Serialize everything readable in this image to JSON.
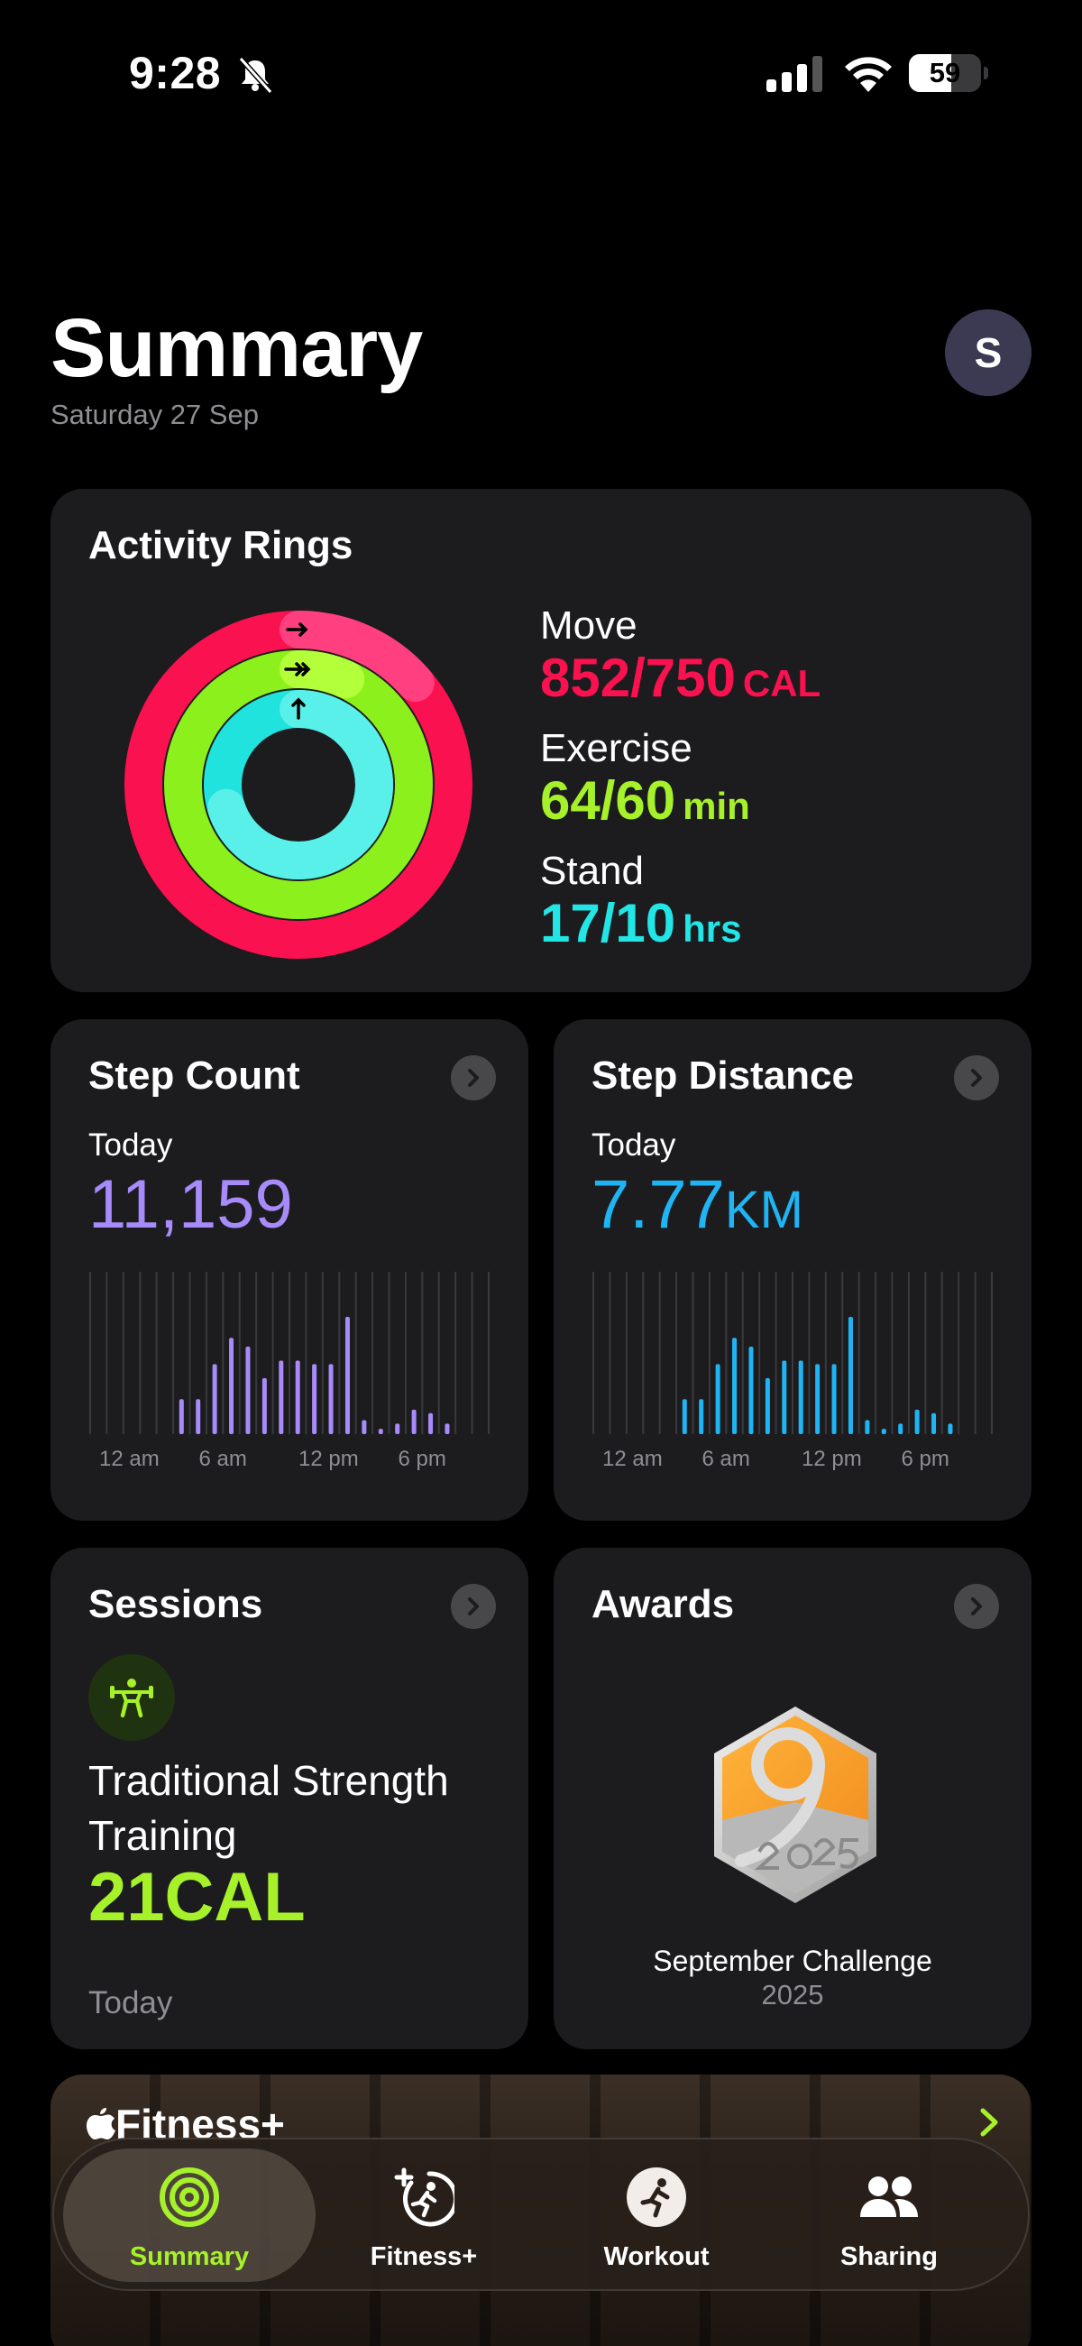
{
  "status_bar": {
    "time": "9:28",
    "battery": "59",
    "battery_level": 0.59
  },
  "header": {
    "title": "Summary",
    "date": "Saturday 27 Sep",
    "avatar_initial": "S"
  },
  "activity": {
    "title": "Activity Rings",
    "move": {
      "label": "Move",
      "value": "852/750",
      "unit": "CAL",
      "progress": 1.136,
      "color": "#fa114f"
    },
    "exercise": {
      "label": "Exercise",
      "value": "64/60",
      "unit": "min",
      "progress": 1.067,
      "color": "#a6f12a"
    },
    "stand": {
      "label": "Stand",
      "value": "17/10",
      "unit": "hrs",
      "progress": 1.7,
      "color": "#22e5e6"
    }
  },
  "step_count": {
    "title": "Step Count",
    "period": "Today",
    "value": "11,159",
    "color": "#a78bfa",
    "axis_labels": [
      "12 am",
      "6 am",
      "12 pm",
      "6 pm"
    ]
  },
  "step_distance": {
    "title": "Step Distance",
    "period": "Today",
    "value": "7.77",
    "unit": "KM",
    "color": "#1fb5f5",
    "axis_labels": [
      "12 am",
      "6 am",
      "12 pm",
      "6 pm"
    ]
  },
  "chart_data": [
    {
      "type": "bar",
      "title": "Step Count",
      "categories": [
        "0",
        "1",
        "2",
        "3",
        "4",
        "5",
        "6",
        "7",
        "8",
        "9",
        "10",
        "11",
        "12",
        "13",
        "14",
        "15",
        "16",
        "17",
        "18",
        "19",
        "20",
        "21",
        "22",
        "23"
      ],
      "x_tick_labels": [
        "12 am",
        "6 am",
        "12 pm",
        "6 pm"
      ],
      "values": [
        0,
        0,
        0,
        0,
        0,
        20,
        20,
        40,
        55,
        50,
        32,
        42,
        42,
        40,
        40,
        67,
        8,
        3,
        6,
        14,
        12,
        6,
        0,
        0
      ],
      "note_scale": "relative"
    },
    {
      "type": "bar",
      "title": "Step Distance",
      "categories": [
        "0",
        "1",
        "2",
        "3",
        "4",
        "5",
        "6",
        "7",
        "8",
        "9",
        "10",
        "11",
        "12",
        "13",
        "14",
        "15",
        "16",
        "17",
        "18",
        "19",
        "20",
        "21",
        "22",
        "23"
      ],
      "x_tick_labels": [
        "12 am",
        "6 am",
        "12 pm",
        "6 pm"
      ],
      "values": [
        0,
        0,
        0,
        0,
        0,
        20,
        20,
        40,
        55,
        50,
        32,
        42,
        42,
        40,
        40,
        67,
        8,
        3,
        6,
        14,
        12,
        6,
        0,
        0
      ],
      "note_scale": "relative"
    }
  ],
  "sessions": {
    "title": "Sessions",
    "workout": "Traditional Strength Training",
    "calories": "21CAL",
    "day": "Today"
  },
  "awards": {
    "title": "Awards",
    "name": "September Challenge",
    "year": "2025"
  },
  "banner": {
    "title": "Fitness+"
  },
  "tabs": [
    {
      "label": "Summary",
      "icon": "activity-rings-icon",
      "active": true
    },
    {
      "label": "Fitness+",
      "icon": "fitness-plus-icon",
      "active": false
    },
    {
      "label": "Workout",
      "icon": "running-figure-icon",
      "active": false
    },
    {
      "label": "Sharing",
      "icon": "people-icon",
      "active": false
    }
  ]
}
